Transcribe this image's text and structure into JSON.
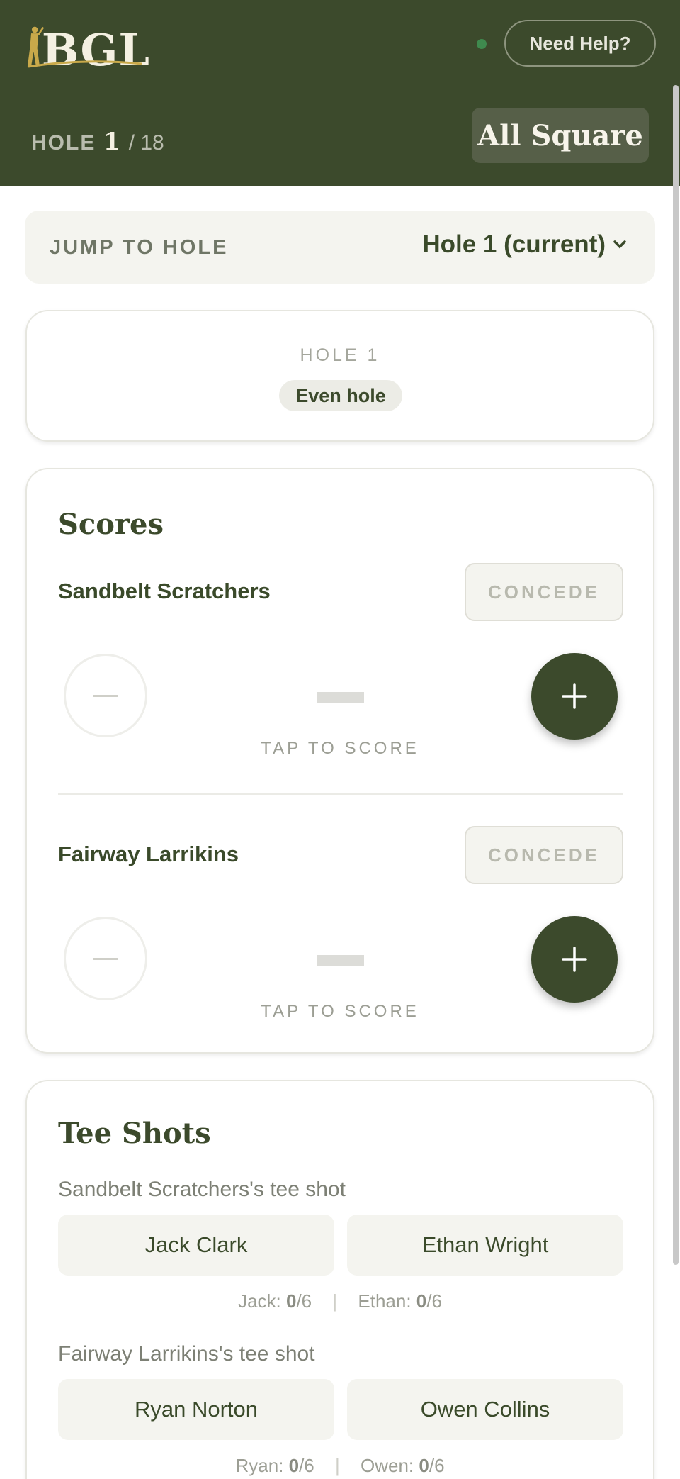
{
  "header": {
    "logo_text": "BGL",
    "help_label": "Need Help?",
    "hole_label": "HOLE",
    "hole_current": "1",
    "hole_total": "/ 18",
    "match_status": "All Square",
    "status_color": "#3f8a4e",
    "background": "#3c4a2c"
  },
  "jump": {
    "label": "JUMP TO HOLE",
    "selected": "Hole 1 (current)",
    "icon": "chevron-down-icon"
  },
  "hole_card": {
    "title": "HOLE 1",
    "badge": "Even hole"
  },
  "scores": {
    "title": "Scores",
    "teams": [
      {
        "name": "Sandbelt Scratchers",
        "concede": "CONCEDE",
        "score": "—",
        "tap_label": "TAP TO SCORE"
      },
      {
        "name": "Fairway Larrikins",
        "concede": "CONCEDE",
        "score": "—",
        "tap_label": "TAP TO SCORE"
      }
    ]
  },
  "tee_shots": {
    "title": "Tee Shots",
    "teams": [
      {
        "label": "Sandbelt Scratchers's tee shot",
        "players": [
          "Jack Clark",
          "Ethan Wright"
        ],
        "tally": [
          {
            "name": "Jack:",
            "count": "0",
            "max": "/6"
          },
          {
            "name": "Ethan:",
            "count": "0",
            "max": "/6"
          }
        ]
      },
      {
        "label": "Fairway Larrikins's tee shot",
        "players": [
          "Ryan Norton",
          "Owen Collins"
        ],
        "tally": [
          {
            "name": "Ryan:",
            "count": "0",
            "max": "/6"
          },
          {
            "name": "Owen:",
            "count": "0",
            "max": "/6"
          }
        ]
      }
    ]
  }
}
